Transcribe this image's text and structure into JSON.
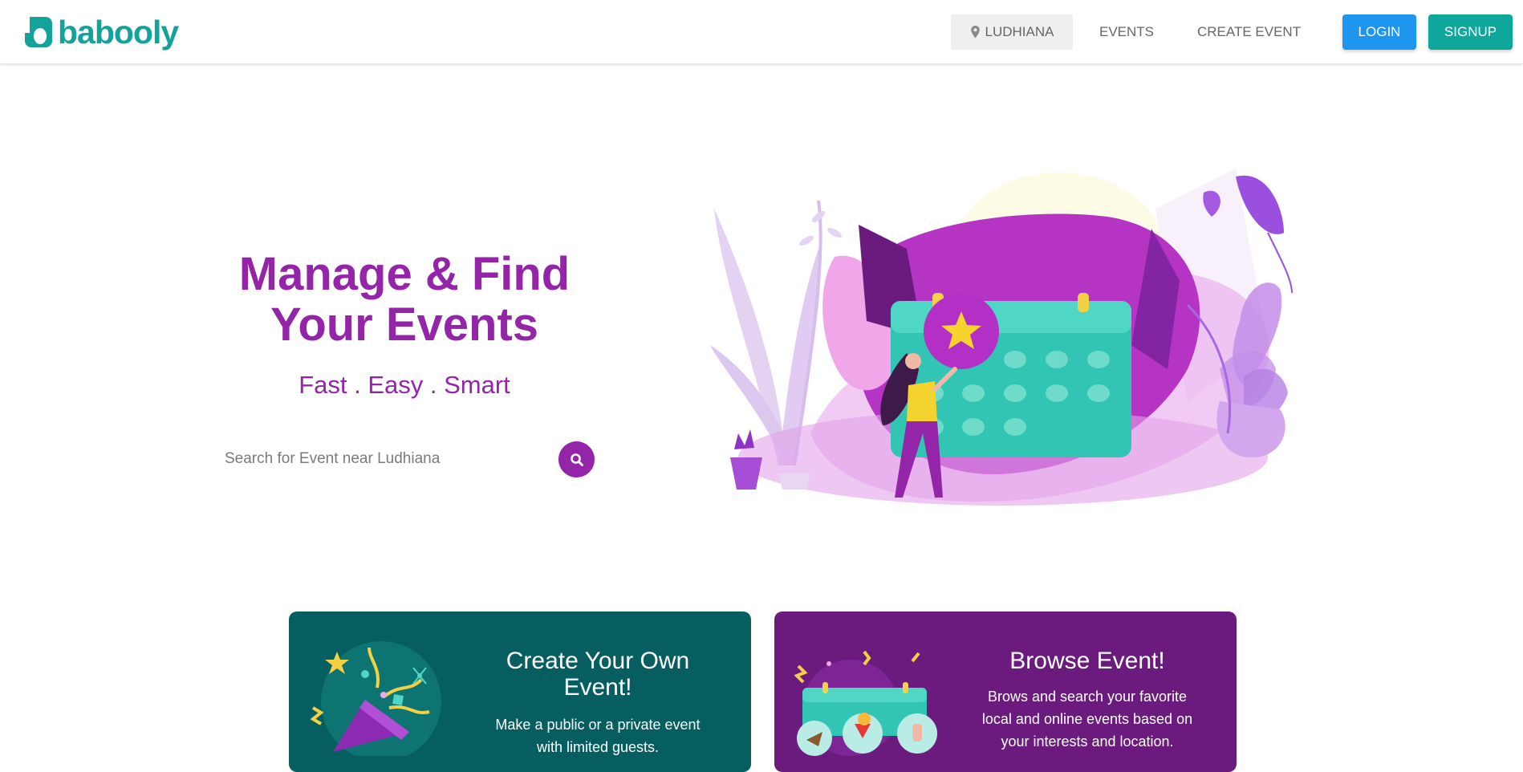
{
  "header": {
    "brand": "babooly",
    "location": "LUDHIANA",
    "nav_events": "EVENTS",
    "nav_create_event": "CREATE EVENT",
    "login_label": "LOGIN",
    "signup_label": "SIGNUP"
  },
  "hero": {
    "title_line1": "Manage & Find",
    "title_line2": "Your Events",
    "tagline": "Fast . Easy . Smart",
    "search_placeholder": "Search for Event near Ludhiana"
  },
  "cards": [
    {
      "title": "Create Your Own Event!",
      "description": "Make a public or a private event with limited guests."
    },
    {
      "title": "Browse Event!",
      "description": "Brows and search your favorite local and online events based on your interests and location."
    }
  ],
  "colors": {
    "brand_teal": "#14a39a",
    "brand_purple": "#9424a8",
    "login_blue": "#1e96f0",
    "card_teal": "#075e61",
    "card_purple": "#6a1b7d"
  },
  "icons": {
    "location": "location-pin-icon",
    "search": "search-icon"
  }
}
